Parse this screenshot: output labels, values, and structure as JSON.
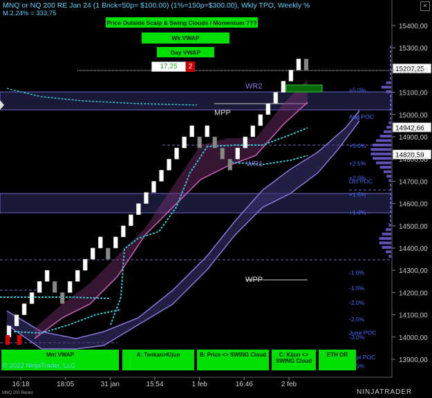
{
  "header": {
    "title": "MNQ or NQ 200 RE Jan 24 (1 Brick=50p= $100.00) (1%=150p=$300.00), Wkly TPO, Weekly %",
    "sub_line_a": "M.2.24%",
    "sub_line_b": "= 333,75"
  },
  "buttons_top": {
    "momentum": "Price Outside Scalp & Swing Clouds / Momentum ???",
    "wk_vwap": "Wk VWAP",
    "day_vwap": "Day VWAP"
  },
  "order_box": {
    "price": "17,25",
    "count": "2"
  },
  "buttons_bottom": {
    "mnt_vwap": "Mnt VWAP",
    "tenkan": "A: Tenkan>Kijun",
    "swing_cloud": "B: Price <> SWING Cloud",
    "kijun_cloud": "C: Kijun <> SWING Cloud",
    "eth_or": "ETH OR"
  },
  "copyright": "© 2022 NinjaTrader, LLC",
  "footer": "MNQ 200 Renko",
  "brand": "NINJATRADER",
  "close_icon": "×",
  "chart_data": {
    "type": "renko",
    "price_axis": {
      "ticks": [
        "15400,00",
        "15300,00",
        "15200,00",
        "15100,00",
        "15000,00",
        "14900,00",
        "14800,00",
        "14700,00",
        "14600,00",
        "14500,00",
        "14400,00",
        "14300,00",
        "14200,00",
        "14100,00",
        "14000,00",
        "13900,00"
      ],
      "ylim": [
        13850,
        15450
      ]
    },
    "price_tags": [
      {
        "label": "15207,25",
        "value": 15207.25
      },
      {
        "label": "14942,66",
        "value": 14942.66
      },
      {
        "label": "14820,59",
        "value": 14820.59
      }
    ],
    "time_axis": [
      "16:18",
      "18:05",
      "31 jan",
      "15:54",
      "1 feb",
      "16:46",
      "2 feb"
    ],
    "level_labels": [
      {
        "text": "WR2",
        "value": 15130
      },
      {
        "text": "MPP",
        "value": 15010
      },
      {
        "text": "WR1",
        "value": 14780
      },
      {
        "text": "WPP",
        "value": 14260
      }
    ],
    "percent_labels": [
      {
        "text": "+5.0%",
        "value": 15110
      },
      {
        "text": "Aug POC",
        "value": 14990
      },
      {
        "text": "+3.0%",
        "value": 14860
      },
      {
        "text": "+2.5%",
        "value": 14780
      },
      {
        "text": "+2.0%",
        "value": 14715
      },
      {
        "text": "Oct POC",
        "value": 14700
      },
      {
        "text": "+1.5%",
        "value": 14640
      },
      {
        "text": "+1.0%",
        "value": 14560
      },
      {
        "text": "-1.0%",
        "value": 14290
      },
      {
        "text": "-1.5%",
        "value": 14220
      },
      {
        "text": "-2.0%",
        "value": 14155
      },
      {
        "text": "-2.5%",
        "value": 14080
      },
      {
        "text": "June POC",
        "value": 14020
      },
      {
        "text": "-3.0%",
        "value": 14000
      },
      {
        "text": "Sept POC",
        "value": 13910
      },
      {
        "text": "-3.5%",
        "value": 13870
      }
    ],
    "bricks": [
      {
        "o": 14000,
        "c": 14050,
        "gray": false
      },
      {
        "o": 14050,
        "c": 14100,
        "gray": false
      },
      {
        "o": 14100,
        "c": 14150,
        "gray": false
      },
      {
        "o": 14150,
        "c": 14200,
        "gray": false
      },
      {
        "o": 14200,
        "c": 14250,
        "gray": false
      },
      {
        "o": 14250,
        "c": 14300,
        "gray": false
      },
      {
        "o": 14250,
        "c": 14200,
        "gray": true
      },
      {
        "o": 14200,
        "c": 14150,
        "gray": true
      },
      {
        "o": 14200,
        "c": 14250,
        "gray": false
      },
      {
        "o": 14250,
        "c": 14300,
        "gray": false
      },
      {
        "o": 14300,
        "c": 14350,
        "gray": false
      },
      {
        "o": 14350,
        "c": 14400,
        "gray": false
      },
      {
        "o": 14400,
        "c": 14450,
        "gray": false
      },
      {
        "o": 14400,
        "c": 14350,
        "gray": true
      },
      {
        "o": 14400,
        "c": 14450,
        "gray": false
      },
      {
        "o": 14450,
        "c": 14500,
        "gray": false
      },
      {
        "o": 14500,
        "c": 14550,
        "gray": false
      },
      {
        "o": 14550,
        "c": 14600,
        "gray": false
      },
      {
        "o": 14600,
        "c": 14650,
        "gray": false
      },
      {
        "o": 14650,
        "c": 14700,
        "gray": false
      },
      {
        "o": 14700,
        "c": 14750,
        "gray": false
      },
      {
        "o": 14750,
        "c": 14800,
        "gray": false
      },
      {
        "o": 14800,
        "c": 14850,
        "gray": false
      },
      {
        "o": 14850,
        "c": 14900,
        "gray": false
      },
      {
        "o": 14900,
        "c": 14950,
        "gray": false
      },
      {
        "o": 14900,
        "c": 14850,
        "gray": true
      },
      {
        "o": 14900,
        "c": 14950,
        "gray": false
      },
      {
        "o": 14900,
        "c": 14850,
        "gray": true
      },
      {
        "o": 14850,
        "c": 14800,
        "gray": true
      },
      {
        "o": 14800,
        "c": 14750,
        "gray": true
      },
      {
        "o": 14800,
        "c": 14850,
        "gray": false
      },
      {
        "o": 14850,
        "c": 14900,
        "gray": false
      },
      {
        "o": 14900,
        "c": 14950,
        "gray": false
      },
      {
        "o": 14950,
        "c": 15000,
        "gray": false
      },
      {
        "o": 15000,
        "c": 15050,
        "gray": false
      },
      {
        "o": 15050,
        "c": 15100,
        "gray": false
      },
      {
        "o": 15100,
        "c": 15150,
        "gray": false
      },
      {
        "o": 15150,
        "c": 15200,
        "gray": false
      },
      {
        "o": 15200,
        "c": 15250,
        "gray": false
      },
      {
        "o": 15250,
        "c": 15200,
        "gray": true
      }
    ]
  }
}
